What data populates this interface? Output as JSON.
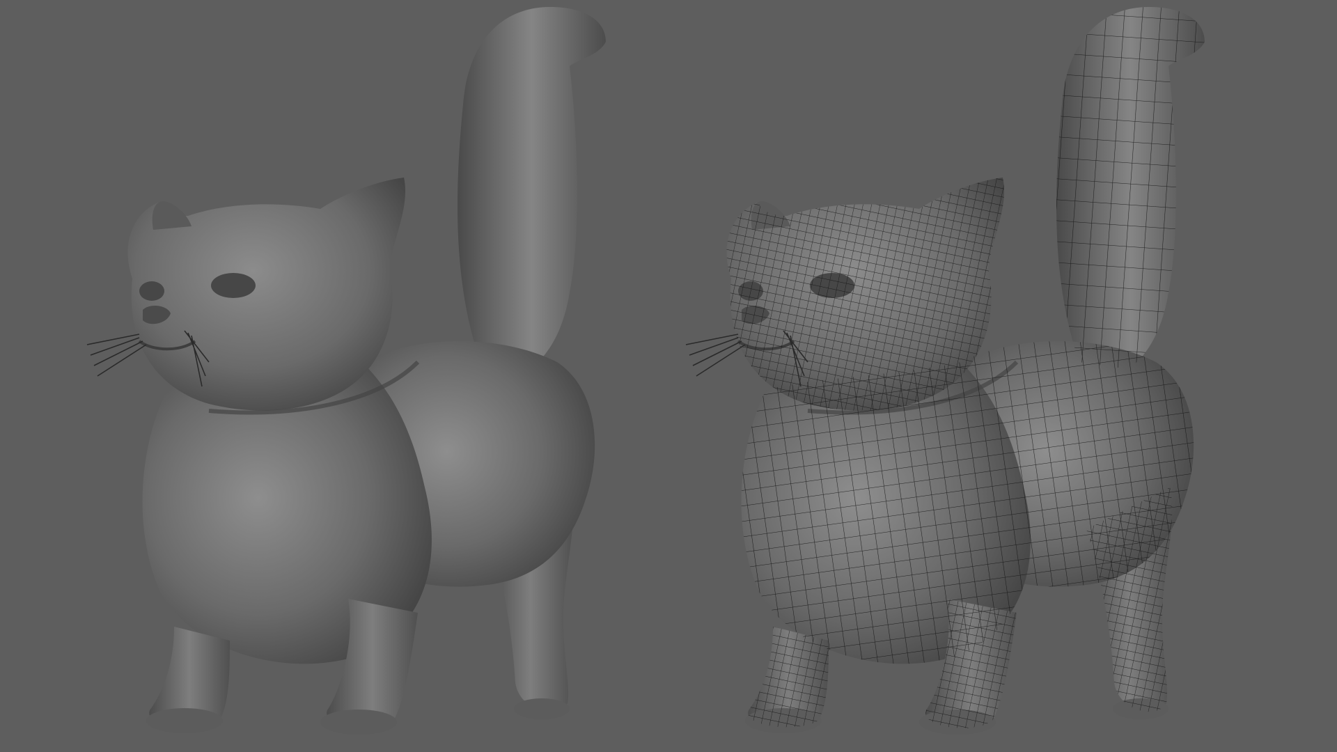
{
  "viewport": {
    "background_color": "#5e5e5e",
    "objects": [
      {
        "name": "cat-model-smooth",
        "shading": "smooth-shaded",
        "wireframe": false
      },
      {
        "name": "cat-model-wireframe",
        "shading": "smooth-shaded",
        "wireframe": true
      }
    ]
  },
  "colors": {
    "model_light": "#8a8a8a",
    "model_mid": "#6c6c6c",
    "model_dark": "#3c3c3c",
    "wire": "#111111"
  }
}
